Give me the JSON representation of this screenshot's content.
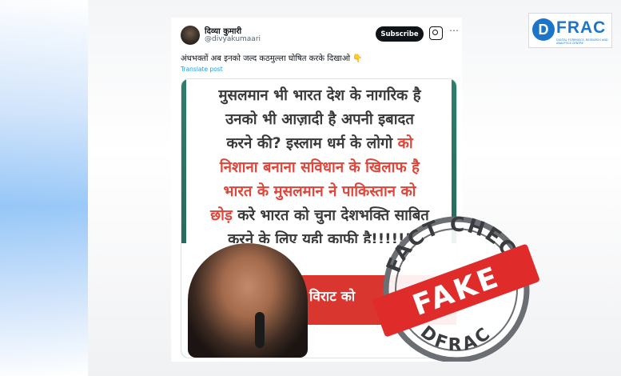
{
  "tweet": {
    "author_name": "दिव्या कुमारी",
    "author_handle": "@divyakumaari",
    "subscribe_label": "Subscribe",
    "text": "अंधभक्तों अब इनको जल्द कठमुल्ला घोषित करके दिखाओ 👇",
    "translate_label": "Translate post"
  },
  "media": {
    "lines": [
      {
        "parts": [
          {
            "text": "मुसलमान भी भारत देश के नागरिक है",
            "color": "dark"
          }
        ]
      },
      {
        "parts": [
          {
            "text": "उनको भी आज़ादी है अपनी इबादत",
            "color": "dark"
          }
        ]
      },
      {
        "parts": [
          {
            "text": "करने की? इस्लाम धर्म के लोगो ",
            "color": "dark"
          },
          {
            "text": "को",
            "color": "red"
          }
        ]
      },
      {
        "parts": [
          {
            "text": "निशाना बनाना सविधान के खिलाफ है",
            "color": "red"
          }
        ]
      },
      {
        "parts": [
          {
            "text": "भारत के मुसलमान ने पाकिस्तान को",
            "color": "red"
          }
        ]
      },
      {
        "parts": [
          {
            "text": "छोड़",
            "color": "red"
          },
          {
            "text": " करे भारत को चुना देशभक्ति साबित",
            "color": "dark"
          }
        ]
      },
      {
        "parts": [
          {
            "text": "करने के लिए यही काफी है!!!!!!",
            "color": "dark"
          }
        ]
      }
    ],
    "band_text": "विराट को"
  },
  "stamp": {
    "top_text": "FACT CHECK",
    "middle_text": "FAKE",
    "bottom_text": "DFRAC"
  },
  "logo": {
    "letter": "D",
    "text": "FRAC",
    "subtitle": "DIGITAL FORENSICS, RESEARCH AND ANALYTICS CENTRE"
  },
  "colors": {
    "stamp_red": "#e02b2b",
    "stamp_grey": "#6b6e72",
    "brand_blue": "#1c75c9"
  }
}
